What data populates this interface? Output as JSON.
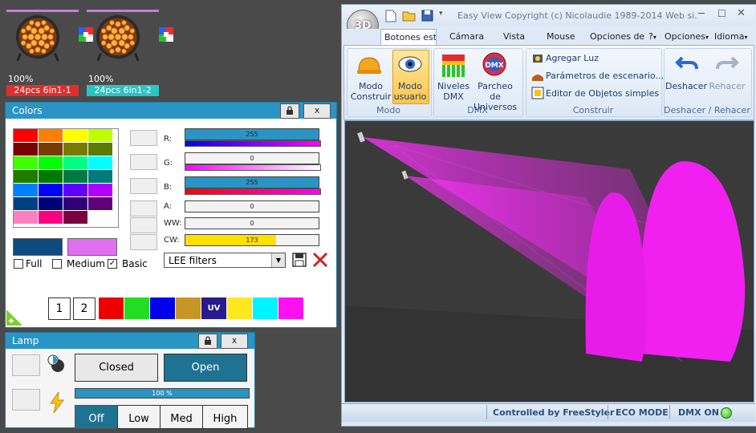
{
  "fixtures": [
    {
      "percent": "100%",
      "name": "24pcs 6in1-1",
      "name_color": "#e22d2d"
    },
    {
      "percent": "100%",
      "name": "24pcs 6in1-2",
      "name_color": "#2bc4c4"
    }
  ],
  "colors_panel": {
    "title": "Colors",
    "close": "x",
    "channels": [
      {
        "label": "R:",
        "value": "255",
        "fill": 1.0,
        "fill_color": "#2a94c4"
      },
      {
        "label": "G:",
        "value": "0",
        "fill": 0.0,
        "fill_color": "#2a94c4"
      },
      {
        "label": "B:",
        "value": "255",
        "fill": 1.0,
        "fill_color": "#2a94c4"
      },
      {
        "label": "A:",
        "value": "0",
        "fill": 0.0,
        "fill_color": "#2a94c4"
      },
      {
        "label": "WW:",
        "value": "0",
        "fill": 0.0,
        "fill_color": "#2a94c4"
      },
      {
        "label": "CW:",
        "value": "173",
        "fill": 0.68,
        "fill_color": "#ffe000"
      }
    ],
    "palette_options": [
      {
        "label": "Full",
        "checked": false
      },
      {
        "label": "Medium",
        "checked": false
      },
      {
        "label": "Basic",
        "checked": true
      }
    ],
    "filter_select": "LEE filters",
    "presets": [
      "1",
      "2"
    ],
    "uv_label": "UV"
  },
  "lamp_panel": {
    "title": "Lamp",
    "close": "x",
    "closed": "Closed",
    "open": "Open",
    "dimmer": "100 %",
    "dimmer_fill": 1.0,
    "modes": [
      "Off",
      "Low",
      "Med",
      "High"
    ]
  },
  "app": {
    "title": "Easy View   Copyright (c) Nicolaudie 1989-2014   Web si...",
    "logo": "3D",
    "tabs": [
      "Botones esta",
      "Cámara",
      "Vista",
      "Mouse",
      "Opciones de",
      "?",
      "Opciones",
      "Idioma"
    ],
    "ribbon": {
      "modo_construir": "Modo Construir",
      "modo_usuario": "Modo usuario",
      "niveles": "Niveles DMX",
      "parcheo": "Parcheo de Universos",
      "agregar_luz": "Agregar Luz",
      "parametros": "Parámetros de escenario...",
      "editor": "Editor de Objetos simples",
      "deshacer": "Deshacer",
      "rehacer": "Rehacer",
      "dmx_logo": "DMX"
    },
    "groups": [
      "Modo",
      "DMX",
      "Construir",
      "Deshacer / Rehacer"
    ],
    "status": [
      "Controlled by FreeStyler",
      "ECO MODE",
      "DMX ON"
    ]
  }
}
